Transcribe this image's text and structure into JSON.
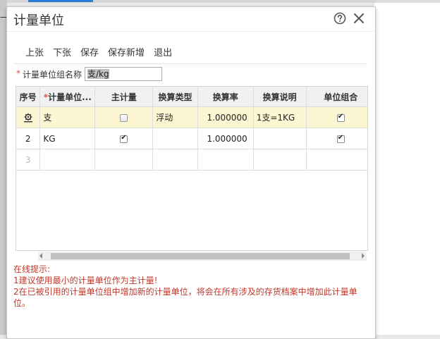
{
  "background": {
    "left_glyph": "一"
  },
  "dialog": {
    "title": "计量单位",
    "help_icon": "help-circle-icon",
    "close_icon": "close-icon"
  },
  "toolbar": {
    "prev_label": "上张",
    "next_label": "下张",
    "save_label": "保存",
    "save_new_label": "保存新增",
    "exit_label": "退出"
  },
  "group_field": {
    "required_mark": "*",
    "label": "计量单位组名称",
    "value": "支/kg"
  },
  "table": {
    "headers": [
      "序号",
      "计量单位...",
      "主计量",
      "换算类型",
      "换算率",
      "换算说明",
      "单位组合"
    ],
    "name_header_required": "*",
    "rows": [
      {
        "index_icon": "gear-row-icon",
        "unit": "支",
        "primary": false,
        "conv_type": "浮动",
        "rate": "1.000000",
        "desc": "1支=1KG",
        "combo": true
      },
      {
        "index": "2",
        "unit": "KG",
        "primary": true,
        "conv_type": "",
        "rate": "1.000000",
        "desc": "",
        "combo": true
      },
      {
        "index": "3",
        "unit": "",
        "primary": null,
        "conv_type": "",
        "rate": "",
        "desc": "",
        "combo": null
      }
    ]
  },
  "tips": {
    "heading": "在线提示:",
    "line1": "1建议使用最小的计量单位作为主计量!",
    "line2": "2在已被引用的计量单位组中增加新的计量单位，将会在所有涉及的存货档案中增加此计量单位。"
  },
  "colors": {
    "accent": "#2f7bd8",
    "tip_red": "#c0392b",
    "active_row": "#fdf6d3",
    "required": "#d9534f"
  }
}
